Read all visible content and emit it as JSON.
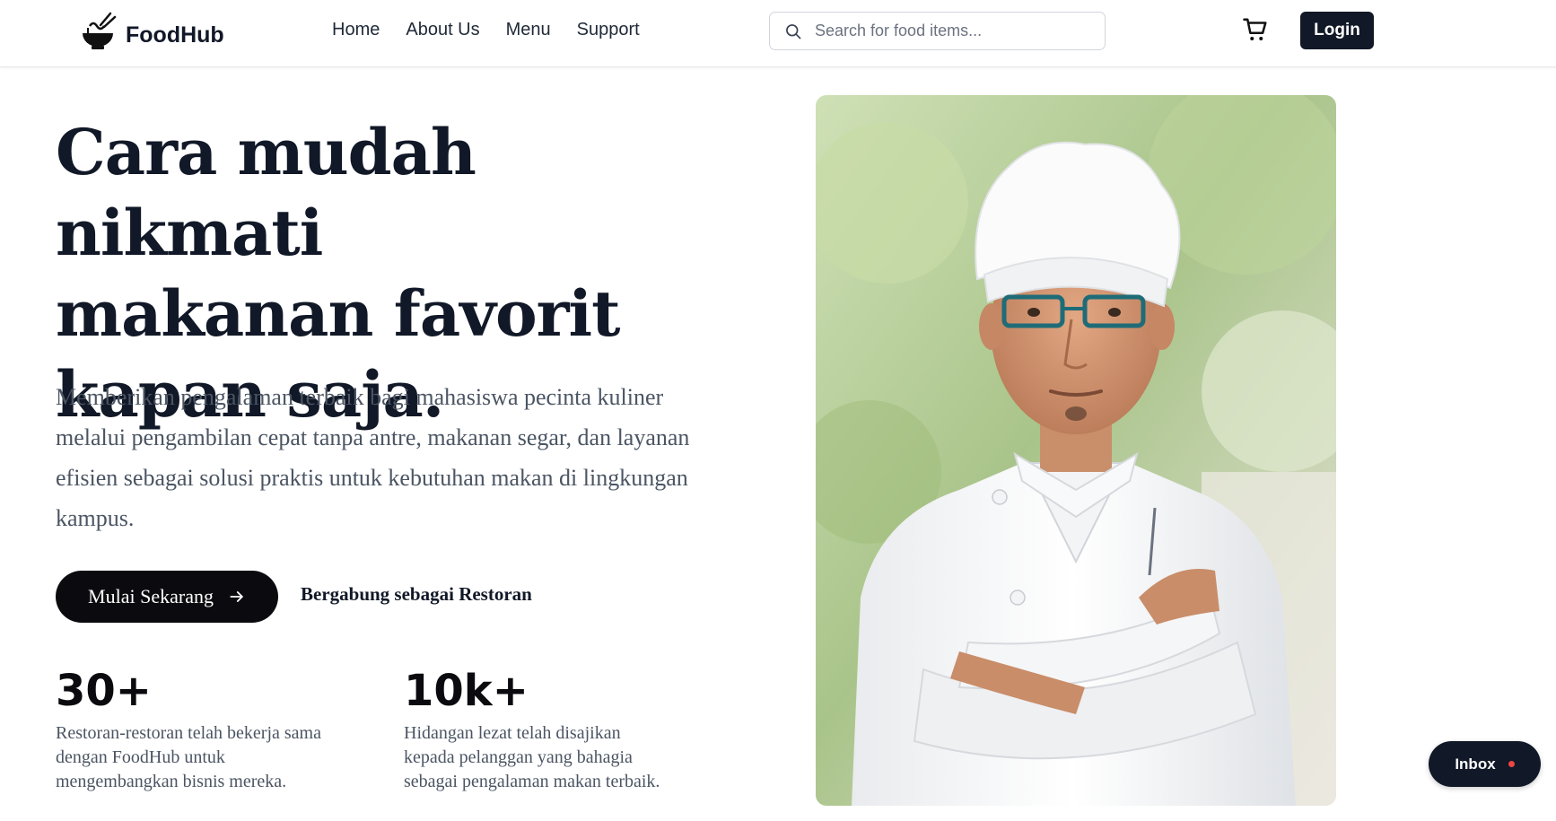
{
  "header": {
    "brand": "FoodHub",
    "nav": [
      "Home",
      "About Us",
      "Menu",
      "Support"
    ],
    "search_placeholder": "Search for food items...",
    "login_label": "Login"
  },
  "hero": {
    "title_lines": [
      "Cara mudah nikmati",
      "makanan favorit",
      "kapan saja."
    ],
    "description": "Memberikan pengalaman terbaik bagi mahasiswa pecinta kuliner melalui pengambilan cepat tanpa antre, makanan segar, dan layanan efisien sebagai solusi praktis untuk kebutuhan makan di lingkungan kampus.",
    "primary_cta": "Mulai Sekarang",
    "secondary_cta": "Bergabung sebagai Restoran"
  },
  "stats": [
    {
      "value": "30+",
      "label": "Restoran-restoran telah bekerja sama dengan FoodHub untuk mengembangkan bisnis mereka."
    },
    {
      "value": "10k+",
      "label": "Hidangan lezat telah disajikan kepada pelanggan yang bahagia sebagai pengalaman makan terbaik."
    }
  ],
  "inbox": {
    "label": "Inbox"
  },
  "colors": {
    "primary": "#111827",
    "accent_dot": "#ef4444",
    "text_muted": "#4b5563"
  },
  "icons": {
    "logo": "noodle-bowl-icon",
    "search": "search-icon",
    "cart": "cart-icon",
    "arrow": "arrow-right-icon"
  }
}
